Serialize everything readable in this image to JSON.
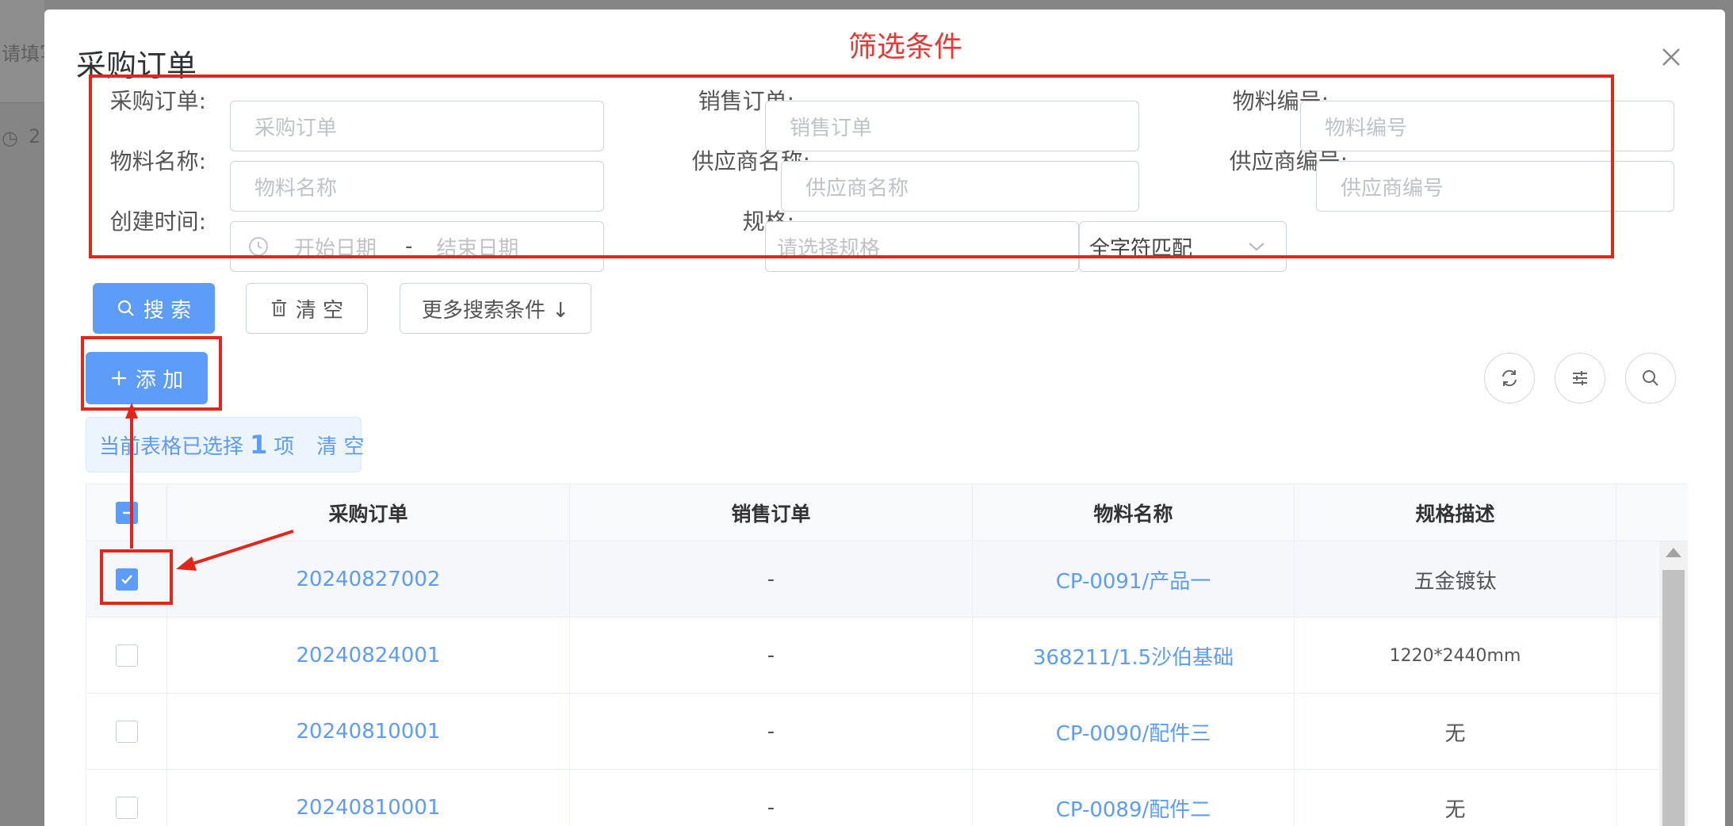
{
  "background": {
    "partial_text": "请填写",
    "partial_date": "2"
  },
  "modal": {
    "title": "采购订单",
    "annotation_label": "筛选条件"
  },
  "filters": {
    "purchase_order": {
      "label": "采购订单:",
      "placeholder": "采购订单"
    },
    "sales_order": {
      "label": "销售订单:",
      "placeholder": "销售订单"
    },
    "material_code": {
      "label": "物料编号:",
      "placeholder": "物料编号"
    },
    "material_name": {
      "label": "物料名称:",
      "placeholder": "物料名称"
    },
    "supplier_name": {
      "label": "供应商名称:",
      "placeholder": "供应商名称"
    },
    "supplier_code": {
      "label": "供应商编号:",
      "placeholder": "供应商编号"
    },
    "created_time": {
      "label": "创建时间:",
      "start_placeholder": "开始日期",
      "separator": "-",
      "end_placeholder": "结束日期"
    },
    "spec": {
      "label": "规格:",
      "placeholder": "请选择规格"
    },
    "match_mode": {
      "value": "全字符匹配"
    }
  },
  "actions": {
    "search": "搜 索",
    "clear": "清 空",
    "more": "更多搜索条件 ↓",
    "add": "添 加"
  },
  "selection": {
    "prefix": "当前表格已选择",
    "count": "1",
    "suffix": "项",
    "clear": "清 空"
  },
  "table": {
    "columns": [
      "采购订单",
      "销售订单",
      "物料名称",
      "规格描述"
    ],
    "rows": [
      {
        "po": "20240827002",
        "so": "-",
        "material": "CP-0091/产品一",
        "spec": "五金镀钛",
        "checked": true
      },
      {
        "po": "20240824001",
        "so": "-",
        "material": "368211/1.5沙伯基础",
        "spec": "1220*2440mm",
        "checked": false
      },
      {
        "po": "20240810001",
        "so": "-",
        "material": "CP-0090/配件三",
        "spec": "无",
        "checked": false
      },
      {
        "po": "20240810001",
        "so": "-",
        "material": "CP-0089/配件二",
        "spec": "无",
        "checked": false
      }
    ]
  },
  "colors": {
    "primary": "#5d9cf8",
    "annotation_red": "#e3261b"
  }
}
